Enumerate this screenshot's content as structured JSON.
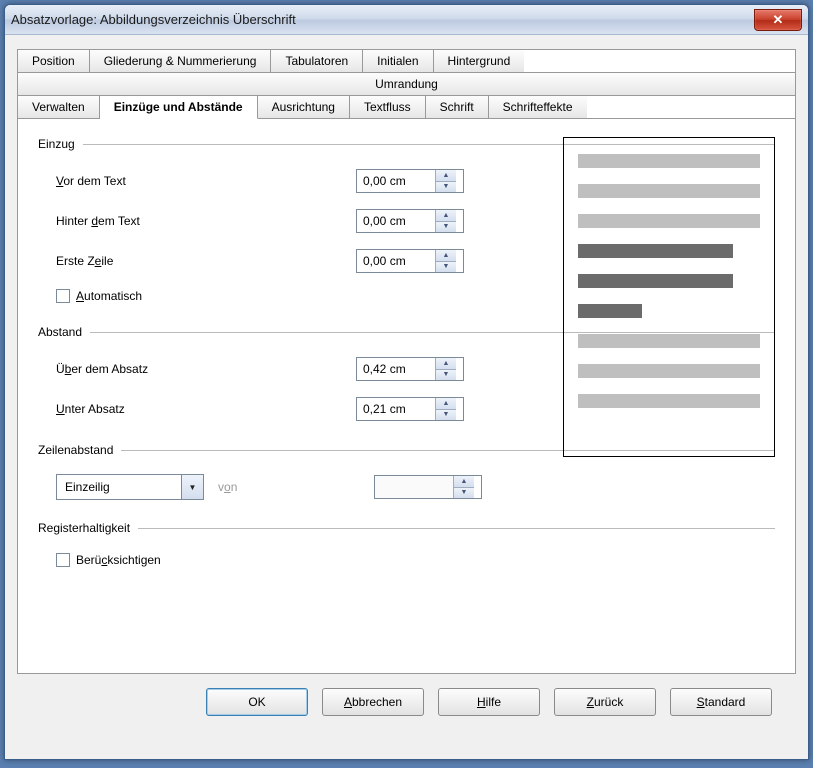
{
  "titlebar": {
    "title": "Absatzvorlage: Abbildungsverzeichnis Überschrift"
  },
  "tabs": {
    "row1": [
      "Position",
      "Gliederung & Nummerierung",
      "Tabulatoren",
      "Initialen",
      "Hintergrund"
    ],
    "row2": [
      "Umrandung"
    ],
    "row3": [
      "Verwalten",
      "Einzüge und Abstände",
      "Ausrichtung",
      "Textfluss",
      "Schrift",
      "Schrifteffekte"
    ],
    "active": "Einzüge und Abstände"
  },
  "indent": {
    "legend": "Einzug",
    "before_label": "Vor dem Text",
    "after_label": "Hinter dem Text",
    "first_label": "Erste Zeile",
    "auto_label": "Automatisch",
    "before_value": "0,00 cm",
    "after_value": "0,00 cm",
    "first_value": "0,00 cm",
    "auto_checked": false
  },
  "spacing": {
    "legend": "Abstand",
    "above_label": "Über dem Absatz",
    "below_label": "Unter Absatz",
    "above_value": "0,42 cm",
    "below_value": "0,21 cm"
  },
  "linespacing": {
    "legend": "Zeilenabstand",
    "mode": "Einzeilig",
    "von_label": "von",
    "von_value": ""
  },
  "register": {
    "legend": "Registerhaltigkeit",
    "consider_label": "Berücksichtigen",
    "consider_checked": false
  },
  "buttons": {
    "ok": "OK",
    "cancel": "Abbrechen",
    "help": "Hilfe",
    "reset": "Zurück",
    "standard": "Standard"
  }
}
